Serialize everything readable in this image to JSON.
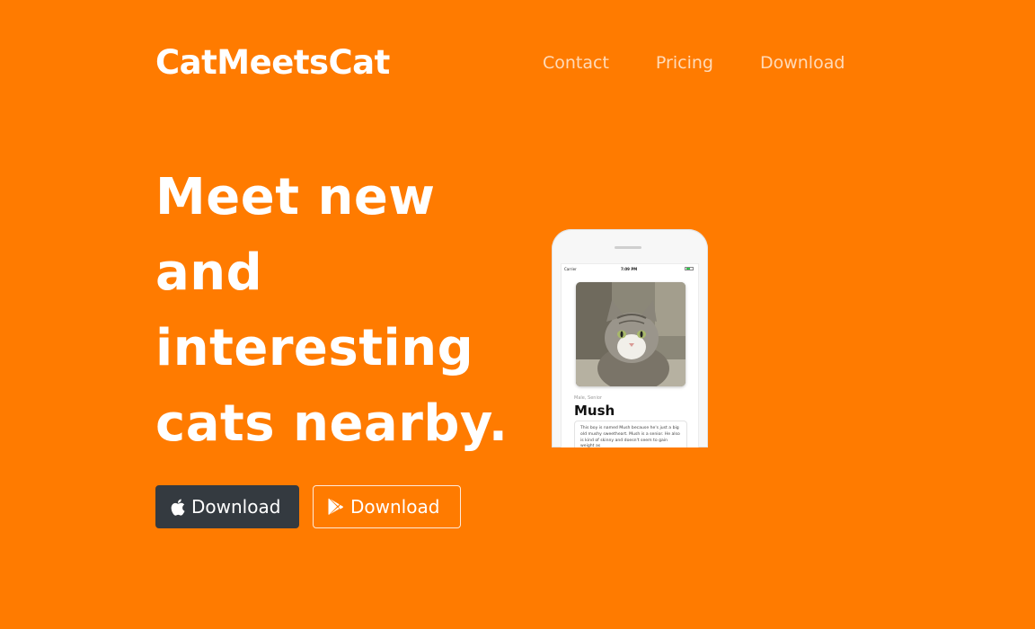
{
  "brand": "CatMeetsCat",
  "nav": {
    "items": [
      "Contact",
      "Pricing",
      "Download"
    ]
  },
  "hero": {
    "headline_lines": [
      "Meet new",
      "and",
      "interesting",
      "cats nearby."
    ]
  },
  "buttons": {
    "apple_label": "Download",
    "apple_icon": "apple-icon",
    "google_label": "Download",
    "google_icon": "google-play-icon"
  },
  "phone": {
    "carrier": "Carrier",
    "time": "7:09 PM",
    "meta": "Male, Senior",
    "cat_name": "Mush",
    "description": "This boy is named Mush because he's just a big old mushy sweetheart. Mush is a senior. He also is kind of skinny and doesn't seem to gain weight as"
  },
  "colors": {
    "background": "#ff7b00",
    "apple_button": "#343a40",
    "text": "#ffffff"
  }
}
